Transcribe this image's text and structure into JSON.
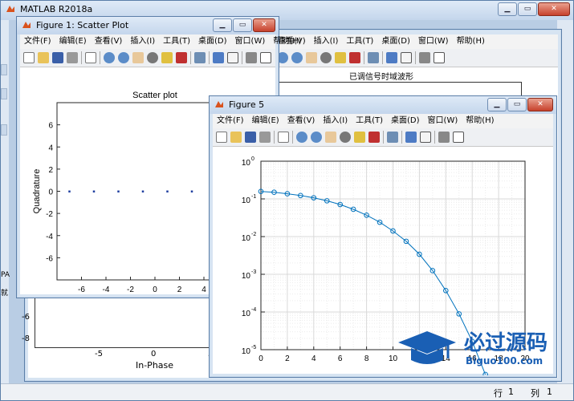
{
  "matlab": {
    "title": "MATLAB R2018a",
    "status": {
      "row_label": "行",
      "row_value": "1",
      "col_label": "列",
      "col_value": "1"
    }
  },
  "fig_bg": {
    "title": "已调信号时域波形",
    "xlabel": "In-Phase",
    "xticks": [
      "-5",
      "0",
      "5"
    ],
    "yticks": [
      "-6",
      "-8"
    ],
    "side_fragments": [
      "PA",
      "就"
    ]
  },
  "fig1": {
    "window_title": "Figure 1: Scatter Plot",
    "menu": [
      "文件(F)",
      "编辑(E)",
      "查看(V)",
      "插入(I)",
      "工具(T)",
      "桌面(D)",
      "窗口(W)",
      "帮助(H)"
    ],
    "chart_data": {
      "type": "scatter",
      "title": "Scatter plot",
      "xlabel": "In-Phase",
      "ylabel": "Quadrature",
      "xlim": [
        -8,
        8
      ],
      "ylim": [
        -8,
        8
      ],
      "xticks": [
        "-6",
        "-4",
        "-2",
        "0",
        "2",
        "4"
      ],
      "yticks": [
        "6",
        "4",
        "2",
        "0",
        "-2",
        "-4",
        "-6"
      ],
      "points": [
        [
          -7,
          0
        ],
        [
          -5,
          0
        ],
        [
          -3,
          0
        ],
        [
          -1,
          0
        ],
        [
          1,
          0
        ],
        [
          3,
          0
        ]
      ]
    }
  },
  "fig2": {
    "menu": [
      "查看(V)",
      "插入(I)",
      "工具(T)",
      "桌面(D)",
      "窗口(W)",
      "帮助(H)"
    ]
  },
  "fig5": {
    "window_title": "Figure 5",
    "menu": [
      "文件(F)",
      "编辑(E)",
      "查看(V)",
      "插入(I)",
      "工具(T)",
      "桌面(D)",
      "窗口(W)",
      "帮助(H)"
    ],
    "chart_data": {
      "type": "line",
      "yscale": "log",
      "xlim": [
        0,
        20
      ],
      "ylim": [
        1e-05,
        1
      ],
      "xticks": [
        "0",
        "2",
        "4",
        "6",
        "8",
        "10",
        "12",
        "14",
        "16",
        "18",
        "20"
      ],
      "ytick_bases": [
        "10",
        "10",
        "10",
        "10",
        "10",
        "10"
      ],
      "ytick_exps": [
        "0",
        "-1",
        "-2",
        "-3",
        "-4",
        "-5"
      ],
      "grid": true,
      "x": [
        0,
        1,
        2,
        3,
        4,
        5,
        6,
        7,
        8,
        9,
        10,
        11,
        12,
        13,
        14,
        15,
        16,
        17
      ],
      "y": [
        0.158,
        0.15,
        0.137,
        0.123,
        0.107,
        0.089,
        0.071,
        0.053,
        0.037,
        0.024,
        0.0141,
        0.0075,
        0.0034,
        0.00125,
        0.00037,
        8.9e-05,
        1.66e-05,
        2.2e-06
      ]
    }
  },
  "watermark": {
    "text": "必过源码",
    "url": "Biguo100.com"
  }
}
